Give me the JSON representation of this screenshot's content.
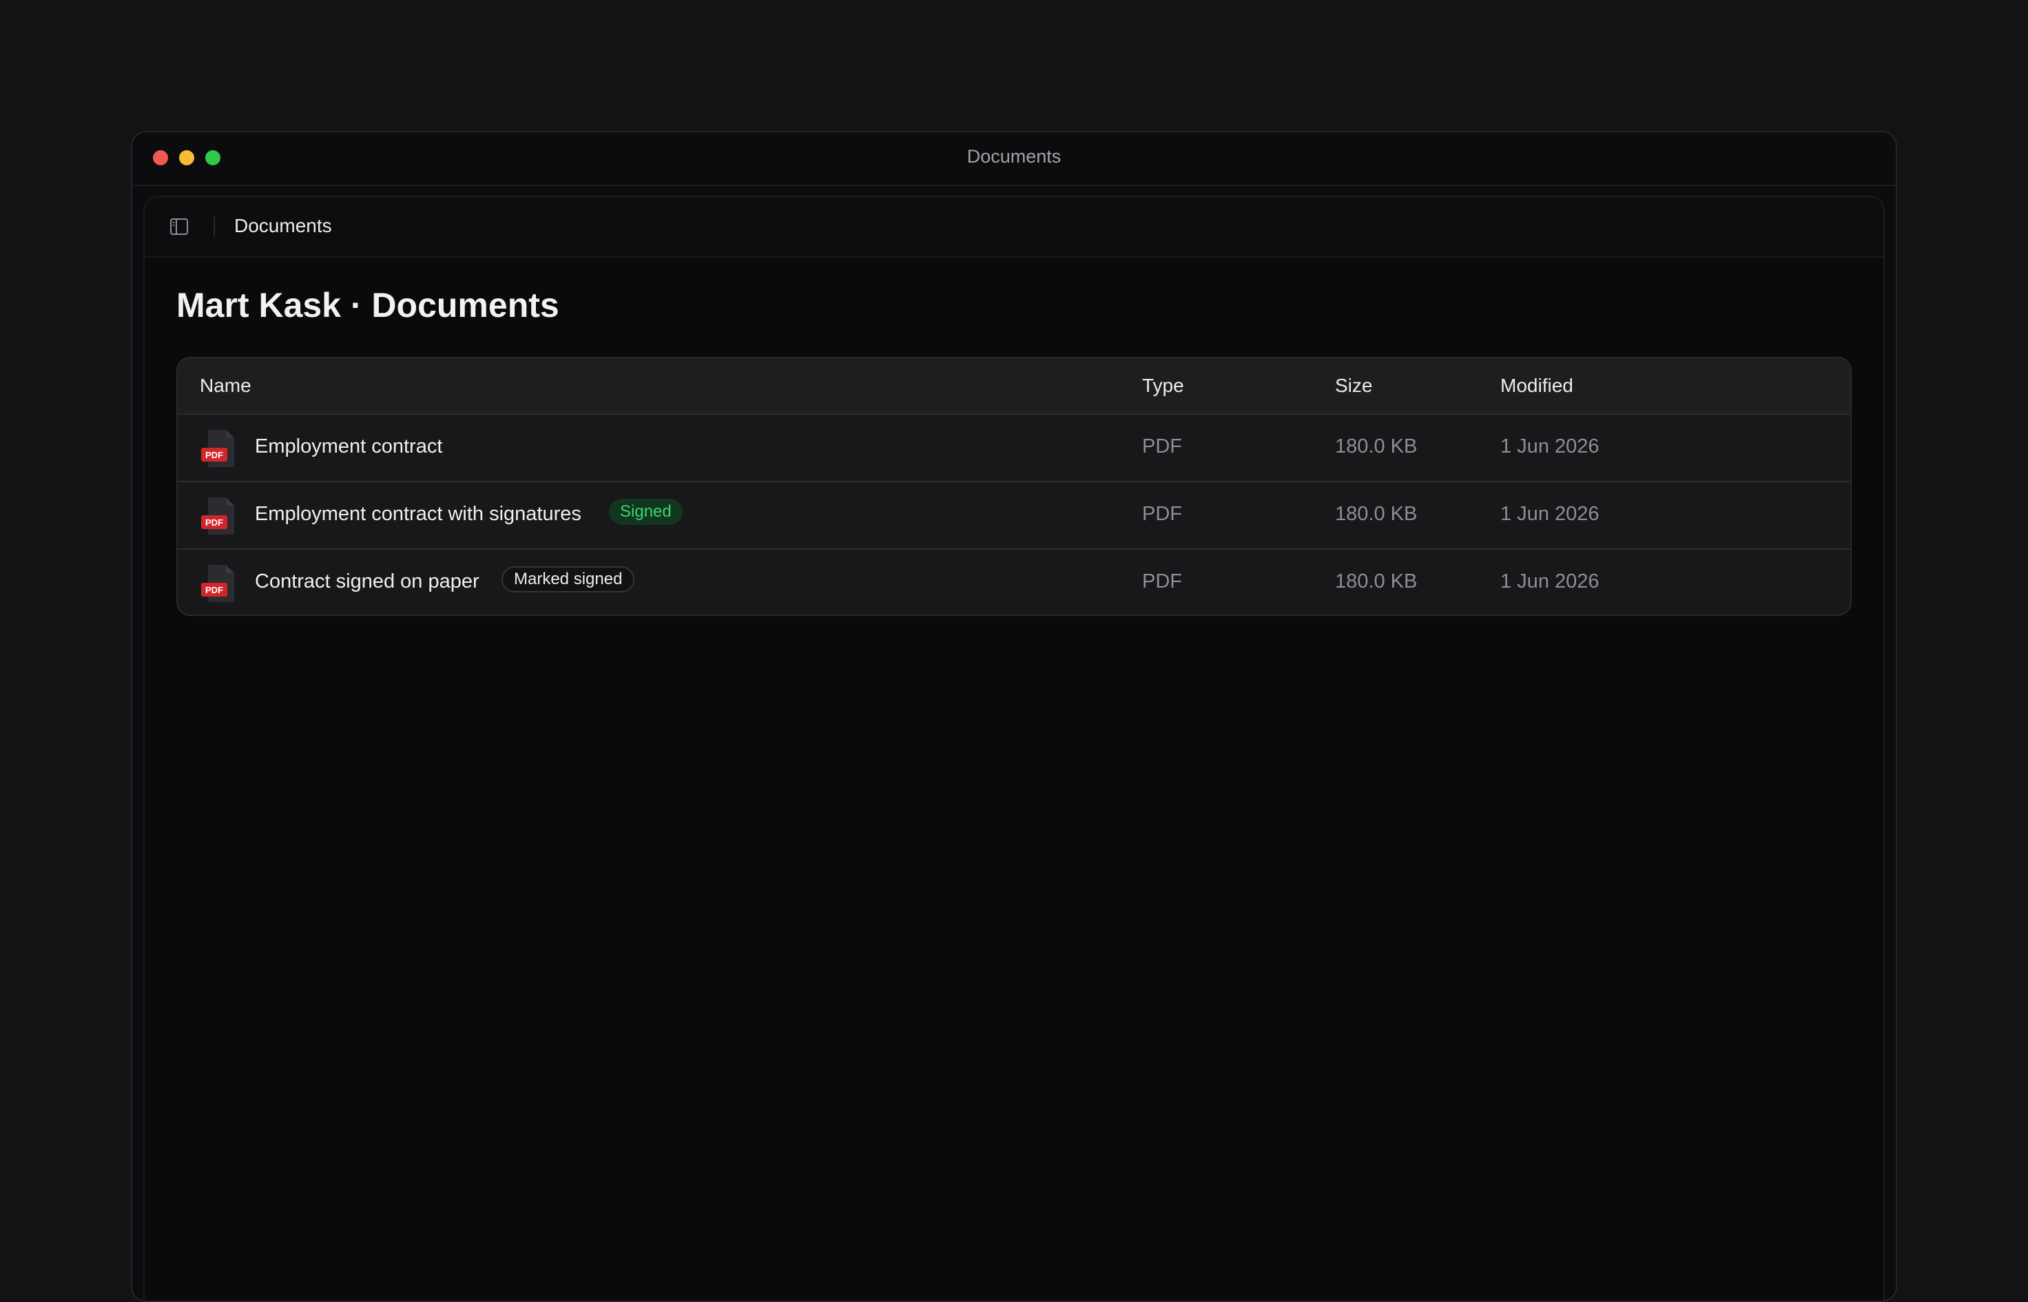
{
  "window": {
    "title": "Documents"
  },
  "header": {
    "title": "Documents",
    "toggle_icon": "sidebar-toggle-icon"
  },
  "page": {
    "title": "Mart Kask · Documents"
  },
  "table": {
    "columns": [
      "Name",
      "Type",
      "Size",
      "Modified"
    ],
    "rows": [
      {
        "icon": "pdf-file-icon",
        "name": "Employment contract",
        "badge": "",
        "type": "PDF",
        "size": "180.0 KB",
        "modified": "1 Jun 2026"
      },
      {
        "icon": "pdf-file-icon",
        "name": "Employment contract with signatures",
        "badge": "Signed",
        "type": "PDF",
        "size": "180.0 KB",
        "modified": "1 Jun 2026"
      },
      {
        "icon": "pdf-file-icon",
        "name": "Contract signed on paper",
        "badge": "Marked signed",
        "type": "PDF",
        "size": "180.0 KB",
        "modified": "1 Jun 2026"
      }
    ]
  },
  "colors": {
    "background": "#131315",
    "window": "#0c0c0e",
    "table": "#18181a",
    "signed_badge_text": "#3ed36b",
    "signed_badge_bg": "#12351f",
    "pdf_red": "#d3262a"
  }
}
